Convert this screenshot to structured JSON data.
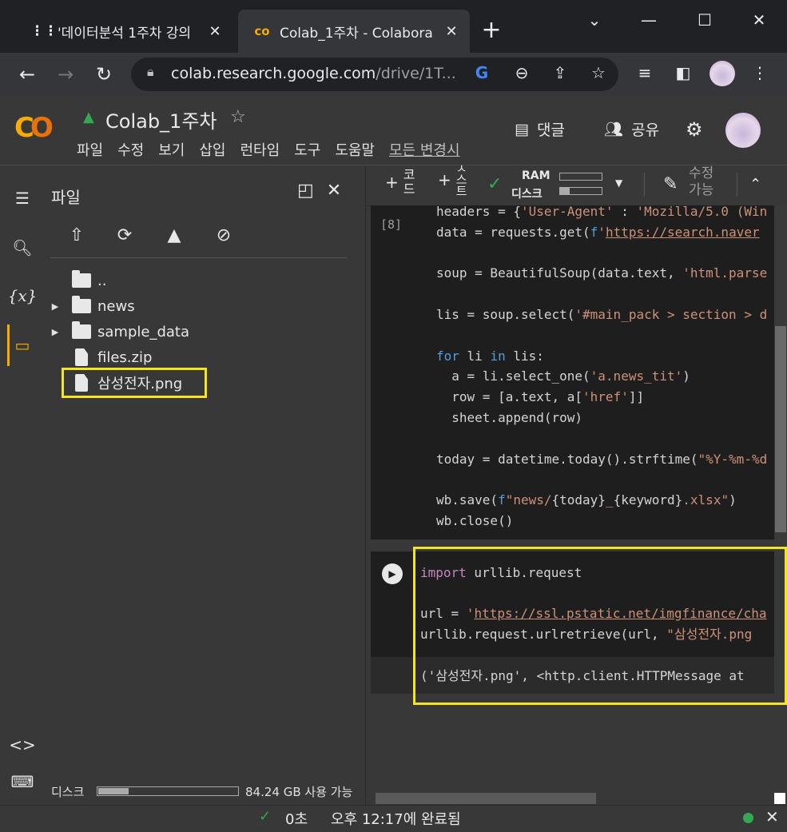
{
  "browser": {
    "tabs": [
      {
        "title": "'데이터분석 1주차 강의",
        "favicon": "tent-icon",
        "active": false
      },
      {
        "title": "Colab_1주차 - Colabora",
        "favicon": "colab-icon",
        "active": true
      }
    ],
    "new_tab": "+",
    "window": {
      "minimize": "⌄",
      "restore": "☐",
      "close": "✕",
      "maximize": "—"
    },
    "url_host": "colab.research.google.com",
    "url_path": "/drive/1T..."
  },
  "colab": {
    "logo": "CO",
    "title": "Colab_1주차",
    "menu": [
      "파일",
      "수정",
      "보기",
      "삽입",
      "런타임",
      "도구",
      "도움말",
      "모든 변경시"
    ],
    "comment_label": "댓글",
    "share_label": "공유"
  },
  "sidebar": {
    "title": "파일",
    "tree": [
      {
        "name": "..",
        "type": "parent",
        "expandable": false
      },
      {
        "name": "news",
        "type": "folder",
        "expandable": true
      },
      {
        "name": "sample_data",
        "type": "folder",
        "expandable": true
      },
      {
        "name": "files.zip",
        "type": "file",
        "expandable": false
      },
      {
        "name": "삼성전자.png",
        "type": "file",
        "expandable": false,
        "highlighted": true
      }
    ],
    "disk_label": "디스크",
    "disk_usage": 0.2,
    "disk_free": "84.24 GB 사용 가능"
  },
  "toolbar": {
    "code_chars": [
      "+",
      "코",
      "드"
    ],
    "text_chars": [
      "+",
      "ㅅ",
      "스",
      "트"
    ],
    "ram_label": "RAM",
    "disk_label": "디스크",
    "ram_usage": 0.0,
    "disk_usage": 0.3,
    "edit_label_line1": "수정",
    "edit_label_line2": "가능"
  },
  "cell1": {
    "exec_count": "[8]"
  },
  "cell2": {
    "output": "('삼성전자.png', <http.client.HTTPMessage at"
  },
  "status": {
    "elapsed": "0초",
    "completed": "오후 12:17에 완료됨"
  }
}
